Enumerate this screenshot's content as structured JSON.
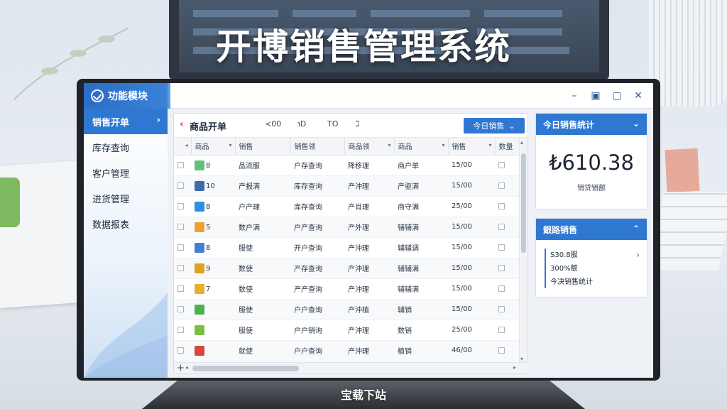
{
  "headline": "开博销售管理系统",
  "caption": "宝载下站",
  "app": {
    "title": "功能模块",
    "window_controls": {
      "minimize": "–",
      "restore": "▣",
      "maximize": "▢",
      "close": "✕"
    }
  },
  "sidebar": {
    "items": [
      {
        "label": "销售开单",
        "active": true,
        "chevron": "›"
      },
      {
        "label": "库存查询"
      },
      {
        "label": "客户管理"
      },
      {
        "label": "进货管理"
      },
      {
        "label": "数据报表"
      }
    ]
  },
  "main": {
    "back_glyph": "‹",
    "title": "商品开单",
    "tool_buttons": [
      "≺00",
      "℩D",
      "TO",
      "ℷ"
    ],
    "today_button": {
      "label": "今日销售",
      "chevron": "⌄"
    },
    "columns": [
      "商品",
      "销售",
      "销售领",
      "商品领",
      "商品",
      "销售",
      "数量"
    ],
    "rows": [
      {
        "code": "8",
        "c1": "品流服",
        "c2": "户存查询",
        "c3": "降移理",
        "c4": "商户单",
        "c5": "15/00",
        "icon_color": "#5ec27a"
      },
      {
        "code": "10",
        "c1": "产报满",
        "c2": "库存查询",
        "c3": "产沖理",
        "c4": "产驱满",
        "c5": "15/00",
        "icon_color": "#3a6ea8"
      },
      {
        "code": "8",
        "c1": "户产理",
        "c2": "库存查询",
        "c3": "产肖理",
        "c4": "商守满",
        "c5": "25/00",
        "icon_color": "#2f8ee0"
      },
      {
        "code": "5",
        "c1": "数户满",
        "c2": "户产查询",
        "c3": "产外理",
        "c4": "辅辅满",
        "c5": "15/00",
        "icon_color": "#f0a030"
      },
      {
        "code": "8",
        "c1": "服使",
        "c2": "开户查询",
        "c3": "产沖理",
        "c4": "辅辅调",
        "c5": "15/00",
        "icon_color": "#3f7fd6"
      },
      {
        "code": "9",
        "c1": "数使",
        "c2": "产存查询",
        "c3": "产沖理",
        "c4": "辅辅满",
        "c5": "15/00",
        "icon_color": "#e0a020"
      },
      {
        "code": "7",
        "c1": "数使",
        "c2": "产产查询",
        "c3": "产沖理",
        "c4": "辅辅满",
        "c5": "15/00",
        "icon_color": "#e8b030"
      },
      {
        "code": "",
        "c1": "服使",
        "c2": "户户查询",
        "c3": "产沖植",
        "c4": "辅销",
        "c5": "15/00",
        "icon_color": "#4caf50"
      },
      {
        "code": "",
        "c1": "服使",
        "c2": "户户销询",
        "c3": "产沖理",
        "c4": "数销",
        "c5": "25/00",
        "icon_color": "#7ac043"
      },
      {
        "code": "",
        "c1": "就使",
        "c2": "户户查询",
        "c3": "产沖理",
        "c4": "植销",
        "c5": "46/00",
        "icon_color": "#d9453a"
      },
      {
        "code": "",
        "c1": "就使",
        "c2": "户户查询",
        "c3": "产沖理",
        "c4": "植销",
        "c5": "15/00",
        "icon_color": "#5a9ae0"
      }
    ],
    "scroll": {
      "plus": "+",
      "left": "◂",
      "right": "▸",
      "up": "▴",
      "down": "▾"
    }
  },
  "sales_card": {
    "title": "今日销售统计",
    "chevron": "⌄",
    "amount": "₺610.38",
    "amount_label": "销贷销额"
  },
  "tips_card": {
    "title": "銀路销售",
    "chevron": "⌃",
    "lines": [
      "S30.8服",
      "300%额",
      "今决销售统计"
    ],
    "line_chevron": "›"
  }
}
